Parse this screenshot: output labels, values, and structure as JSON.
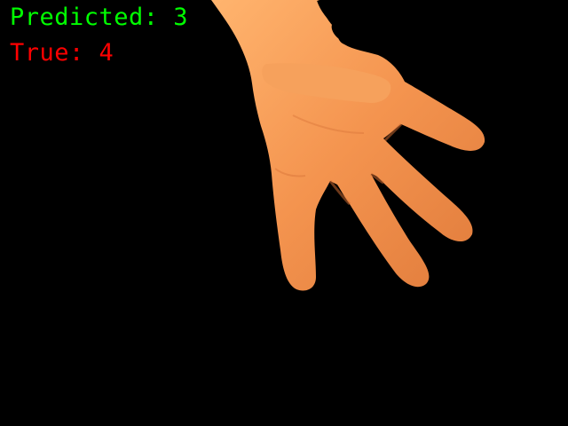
{
  "overlay": {
    "predicted_label": "Predicted: 3",
    "true_label": "True: 4",
    "predicted_color": "#00ff00",
    "true_color": "#ff0000"
  },
  "scene": {
    "background_color": "#000000",
    "subject": "hand",
    "skin_color": "#f4944f",
    "skin_shadow_color": "#d9763a"
  }
}
